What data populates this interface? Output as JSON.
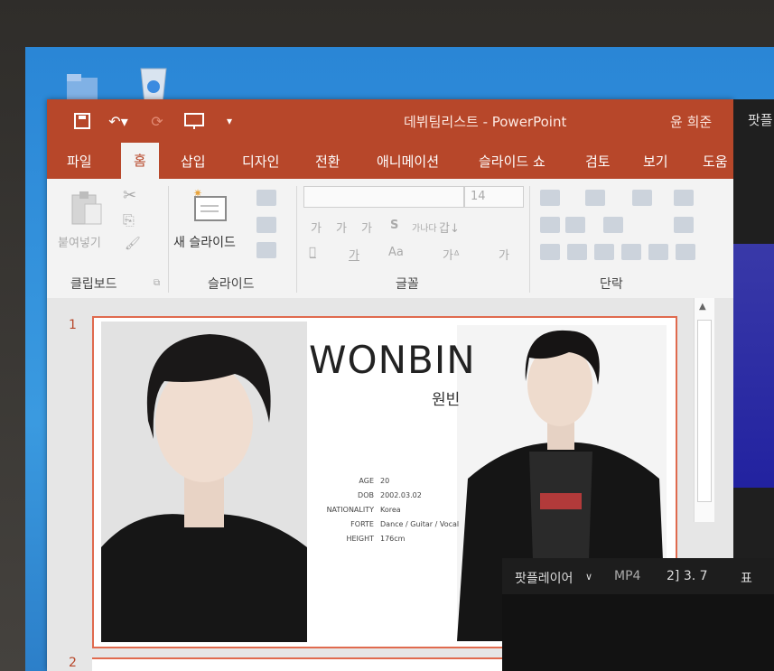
{
  "window": {
    "title": "데뷔팀리스트 - PowerPoint",
    "user": "윤 희준"
  },
  "tabs": [
    "파일",
    "홈",
    "삽입",
    "디자인",
    "전환",
    "애니메이션",
    "슬라이드 쇼",
    "검토",
    "보기",
    "도움"
  ],
  "ribbon": {
    "paste_label": "붙여넣기",
    "new_slide_label": "새 슬라이드",
    "font_size": "14",
    "groups": [
      "클립보드",
      "슬라이드",
      "글꼴",
      "단락"
    ]
  },
  "slide": {
    "number": "1",
    "title": "WONBIN",
    "subtitle": "원빈",
    "info": [
      {
        "key": "AGE",
        "value": "20"
      },
      {
        "key": "DOB",
        "value": "2002.03.02"
      },
      {
        "key": "NATIONALITY",
        "value": "Korea"
      },
      {
        "key": "FORTE",
        "value": "Dance / Guitar / Vocal"
      },
      {
        "key": "HEIGHT",
        "value": "176cm"
      }
    ]
  },
  "slide2": {
    "number": "2"
  },
  "side_panel": {
    "title": "팟플"
  },
  "player": {
    "app": "팟플레이어",
    "format": "MP4",
    "info": "2] 3. 7",
    "extra": "표"
  },
  "colors": {
    "accent": "#b7472a",
    "slide_border": "#e06a4e",
    "desktop": "#2a86d6"
  }
}
